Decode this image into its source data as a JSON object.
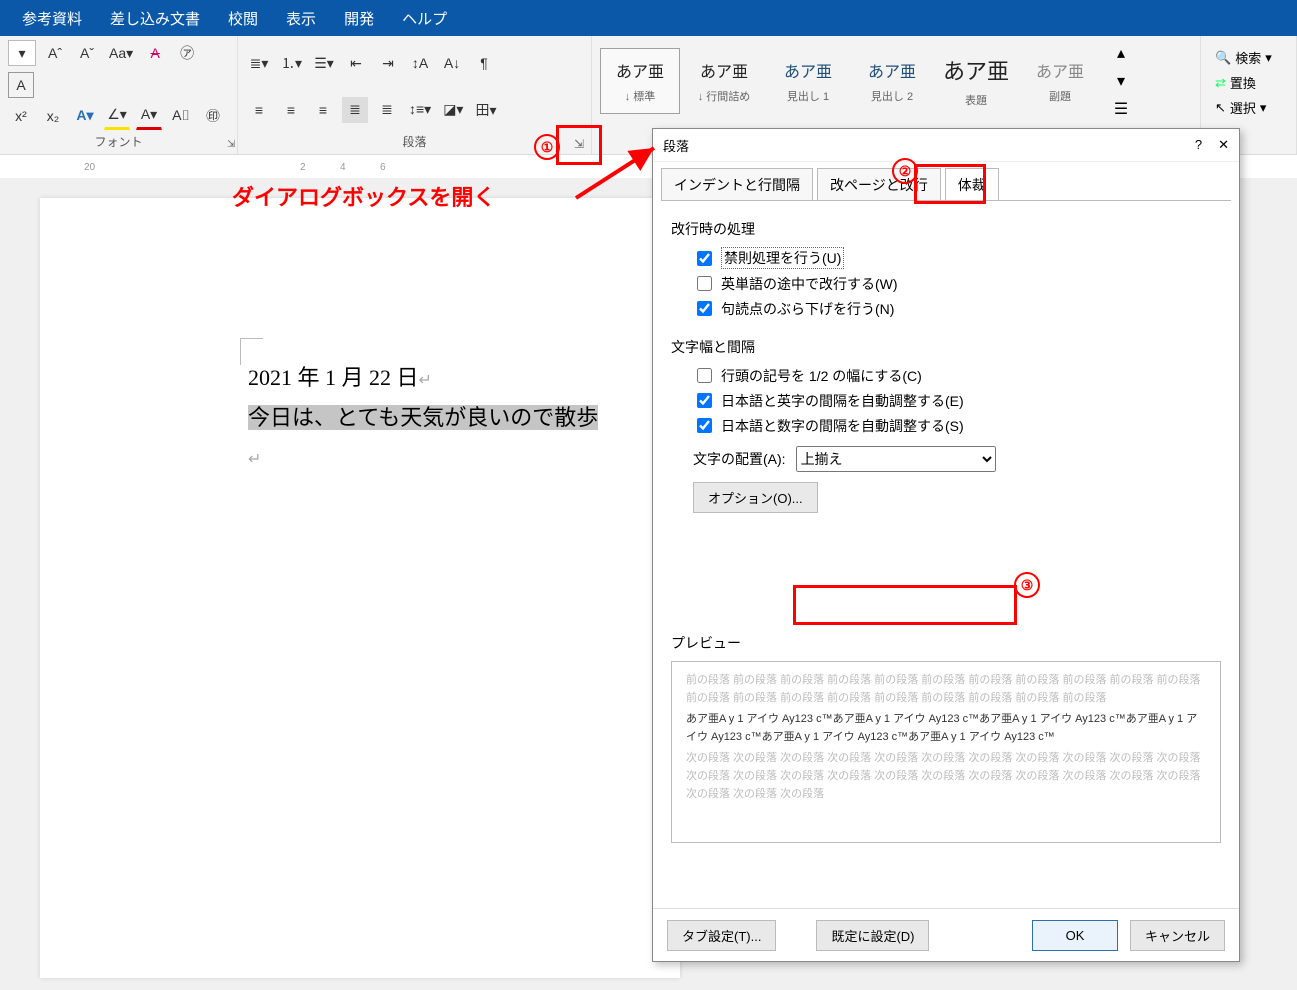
{
  "tabs": {
    "t1": "参考資料",
    "t2": "差し込み文書",
    "t3": "校閲",
    "t4": "表示",
    "t5": "開発",
    "t6": "ヘルプ"
  },
  "ribbon": {
    "font_group": "フォント",
    "para_group": "段落",
    "styles": [
      {
        "sample": "あア亜",
        "name": "↓ 標準"
      },
      {
        "sample": "あア亜",
        "name": "↓ 行間詰め"
      },
      {
        "sample": "あア亜",
        "name": "見出し 1"
      },
      {
        "sample": "あア亜",
        "name": "見出し 2"
      },
      {
        "sample": "あア亜",
        "name": "表題"
      },
      {
        "sample": "あア亜",
        "name": "副題"
      }
    ],
    "editing": {
      "find": "検索",
      "replace": "置換",
      "select": "選択"
    }
  },
  "doc": {
    "date_line": "2021 年 1 月 22 日",
    "body_line": "今日は、とても天気が良いので散歩"
  },
  "dialog": {
    "title": "段落",
    "tab1": "インデントと行間隔",
    "tab2": "改ページと改行",
    "tab3": "体裁",
    "sec1": "改行時の処理",
    "c1": "禁則処理を行う(U)",
    "c2": "英単語の途中で改行する(W)",
    "c3": "句読点のぶら下げを行う(N)",
    "sec2": "文字幅と間隔",
    "c4": "行頭の記号を 1/2 の幅にする(C)",
    "c5": "日本語と英字の間隔を自動調整する(E)",
    "c6": "日本語と数字の間隔を自動調整する(S)",
    "align_label": "文字の配置(A):",
    "align_value": "上揃え",
    "options_btn": "オプション(O)...",
    "preview_label": "プレビュー",
    "preview_prev": "前の段落 前の段落 前の段落 前の段落 前の段落 前の段落 前の段落 前の段落 前の段落 前の段落 前の段落 前の段落 前の段落 前の段落 前の段落 前の段落 前の段落 前の段落 前の段落 前の段落",
    "preview_sample": "あア亜A y  1  アイウ Ay123 c™あア亜A y  1  アイウ Ay123 c™あア亜A y  1  アイウ Ay123 c™あア亜A y  1  アイウ Ay123 c™あア亜A y  1  アイウ Ay123 c™あア亜A y  1  アイウ Ay123 c™",
    "preview_next": "次の段落 次の段落 次の段落 次の段落 次の段落 次の段落 次の段落 次の段落 次の段落 次の段落 次の段落 次の段落 次の段落 次の段落 次の段落 次の段落 次の段落 次の段落 次の段落 次の段落 次の段落 次の段落 次の段落 次の段落 次の段落",
    "tab_btn": "タブ設定(T)...",
    "default_btn": "既定に設定(D)",
    "ok": "OK",
    "cancel": "キャンセル"
  },
  "anno": {
    "open": "ダイアログボックスを開く",
    "n1": "①",
    "n2": "②",
    "n3": "③"
  }
}
